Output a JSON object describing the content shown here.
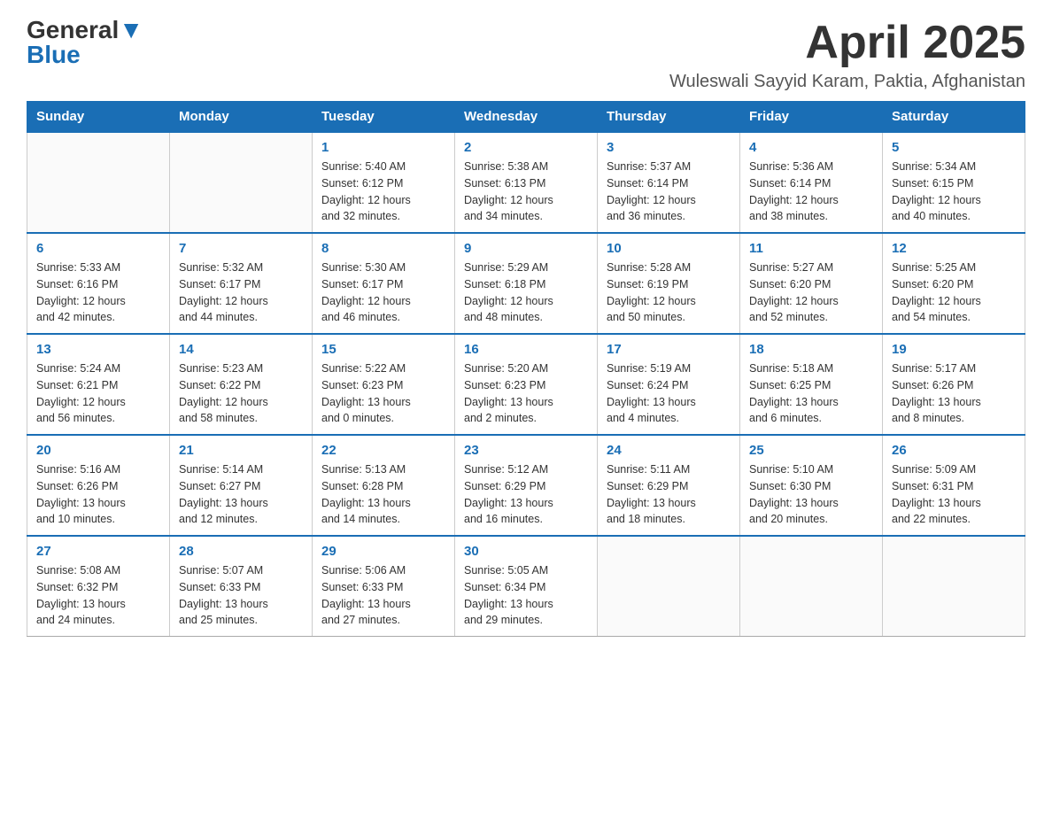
{
  "header": {
    "logo_general": "General",
    "logo_blue": "Blue",
    "month_title": "April 2025",
    "location": "Wuleswali Sayyid Karam, Paktia, Afghanistan"
  },
  "days_of_week": [
    "Sunday",
    "Monday",
    "Tuesday",
    "Wednesday",
    "Thursday",
    "Friday",
    "Saturday"
  ],
  "weeks": [
    [
      {
        "day": "",
        "info": ""
      },
      {
        "day": "",
        "info": ""
      },
      {
        "day": "1",
        "info": "Sunrise: 5:40 AM\nSunset: 6:12 PM\nDaylight: 12 hours\nand 32 minutes."
      },
      {
        "day": "2",
        "info": "Sunrise: 5:38 AM\nSunset: 6:13 PM\nDaylight: 12 hours\nand 34 minutes."
      },
      {
        "day": "3",
        "info": "Sunrise: 5:37 AM\nSunset: 6:14 PM\nDaylight: 12 hours\nand 36 minutes."
      },
      {
        "day": "4",
        "info": "Sunrise: 5:36 AM\nSunset: 6:14 PM\nDaylight: 12 hours\nand 38 minutes."
      },
      {
        "day": "5",
        "info": "Sunrise: 5:34 AM\nSunset: 6:15 PM\nDaylight: 12 hours\nand 40 minutes."
      }
    ],
    [
      {
        "day": "6",
        "info": "Sunrise: 5:33 AM\nSunset: 6:16 PM\nDaylight: 12 hours\nand 42 minutes."
      },
      {
        "day": "7",
        "info": "Sunrise: 5:32 AM\nSunset: 6:17 PM\nDaylight: 12 hours\nand 44 minutes."
      },
      {
        "day": "8",
        "info": "Sunrise: 5:30 AM\nSunset: 6:17 PM\nDaylight: 12 hours\nand 46 minutes."
      },
      {
        "day": "9",
        "info": "Sunrise: 5:29 AM\nSunset: 6:18 PM\nDaylight: 12 hours\nand 48 minutes."
      },
      {
        "day": "10",
        "info": "Sunrise: 5:28 AM\nSunset: 6:19 PM\nDaylight: 12 hours\nand 50 minutes."
      },
      {
        "day": "11",
        "info": "Sunrise: 5:27 AM\nSunset: 6:20 PM\nDaylight: 12 hours\nand 52 minutes."
      },
      {
        "day": "12",
        "info": "Sunrise: 5:25 AM\nSunset: 6:20 PM\nDaylight: 12 hours\nand 54 minutes."
      }
    ],
    [
      {
        "day": "13",
        "info": "Sunrise: 5:24 AM\nSunset: 6:21 PM\nDaylight: 12 hours\nand 56 minutes."
      },
      {
        "day": "14",
        "info": "Sunrise: 5:23 AM\nSunset: 6:22 PM\nDaylight: 12 hours\nand 58 minutes."
      },
      {
        "day": "15",
        "info": "Sunrise: 5:22 AM\nSunset: 6:23 PM\nDaylight: 13 hours\nand 0 minutes."
      },
      {
        "day": "16",
        "info": "Sunrise: 5:20 AM\nSunset: 6:23 PM\nDaylight: 13 hours\nand 2 minutes."
      },
      {
        "day": "17",
        "info": "Sunrise: 5:19 AM\nSunset: 6:24 PM\nDaylight: 13 hours\nand 4 minutes."
      },
      {
        "day": "18",
        "info": "Sunrise: 5:18 AM\nSunset: 6:25 PM\nDaylight: 13 hours\nand 6 minutes."
      },
      {
        "day": "19",
        "info": "Sunrise: 5:17 AM\nSunset: 6:26 PM\nDaylight: 13 hours\nand 8 minutes."
      }
    ],
    [
      {
        "day": "20",
        "info": "Sunrise: 5:16 AM\nSunset: 6:26 PM\nDaylight: 13 hours\nand 10 minutes."
      },
      {
        "day": "21",
        "info": "Sunrise: 5:14 AM\nSunset: 6:27 PM\nDaylight: 13 hours\nand 12 minutes."
      },
      {
        "day": "22",
        "info": "Sunrise: 5:13 AM\nSunset: 6:28 PM\nDaylight: 13 hours\nand 14 minutes."
      },
      {
        "day": "23",
        "info": "Sunrise: 5:12 AM\nSunset: 6:29 PM\nDaylight: 13 hours\nand 16 minutes."
      },
      {
        "day": "24",
        "info": "Sunrise: 5:11 AM\nSunset: 6:29 PM\nDaylight: 13 hours\nand 18 minutes."
      },
      {
        "day": "25",
        "info": "Sunrise: 5:10 AM\nSunset: 6:30 PM\nDaylight: 13 hours\nand 20 minutes."
      },
      {
        "day": "26",
        "info": "Sunrise: 5:09 AM\nSunset: 6:31 PM\nDaylight: 13 hours\nand 22 minutes."
      }
    ],
    [
      {
        "day": "27",
        "info": "Sunrise: 5:08 AM\nSunset: 6:32 PM\nDaylight: 13 hours\nand 24 minutes."
      },
      {
        "day": "28",
        "info": "Sunrise: 5:07 AM\nSunset: 6:33 PM\nDaylight: 13 hours\nand 25 minutes."
      },
      {
        "day": "29",
        "info": "Sunrise: 5:06 AM\nSunset: 6:33 PM\nDaylight: 13 hours\nand 27 minutes."
      },
      {
        "day": "30",
        "info": "Sunrise: 5:05 AM\nSunset: 6:34 PM\nDaylight: 13 hours\nand 29 minutes."
      },
      {
        "day": "",
        "info": ""
      },
      {
        "day": "",
        "info": ""
      },
      {
        "day": "",
        "info": ""
      }
    ]
  ]
}
